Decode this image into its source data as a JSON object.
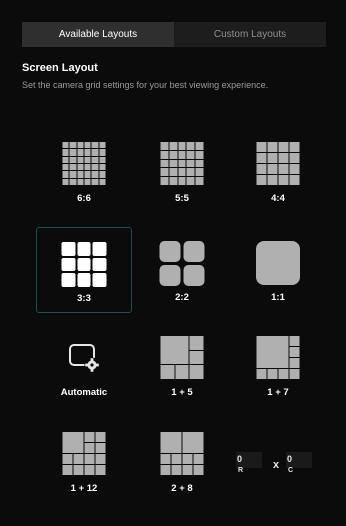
{
  "tabs": {
    "available": "Available Layouts",
    "custom": "Custom Layouts"
  },
  "header": {
    "title": "Screen Layout",
    "subtitle": "Set the camera grid settings for your best viewing experience."
  },
  "layouts": {
    "l66": "6:6",
    "l55": "5:5",
    "l44": "4:4",
    "l33": "3:3",
    "l22": "2:2",
    "l11": "1:1",
    "automatic": "Automatic",
    "l15": "1 + 5",
    "l17": "1 + 7",
    "l112": "1 + 12",
    "l28": "2 + 8"
  },
  "custom_grid": {
    "rows_value": "0",
    "rows_label": "R",
    "cols_value": "0",
    "cols_label": "C",
    "times": "x"
  },
  "colors": {
    "selected_border": "#1f4d52",
    "tile": "#b0b0b0",
    "selected_tile": "#ffffff"
  }
}
